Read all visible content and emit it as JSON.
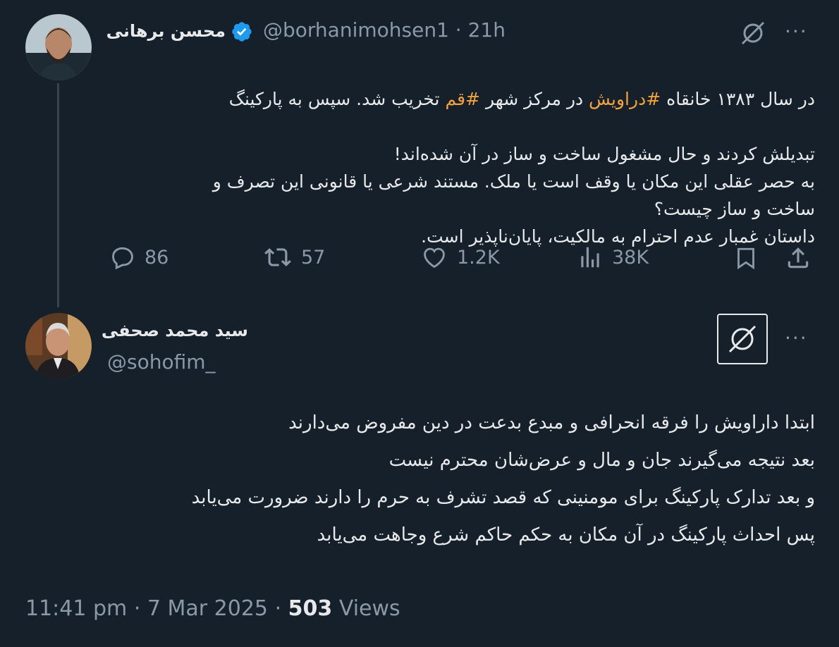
{
  "tweet1": {
    "author_name": "محسن برهانی",
    "handle": "@borhanimohsen1",
    "separator": "·",
    "time": "21h",
    "line1_a": "در سال ۱۳۸۳ خانقاه ",
    "line1_tag1": "#دراویش",
    "line1_b": " در مرکز شهر ",
    "line1_tag2": "#قم",
    "line1_c": " تخریب شد. سپس به پارکینگ",
    "lines_rest": "تبدیلش کردند و حال مشغول ساخت و ساز در آن شده‌اند!\nبه حصر عقلی این مکان یا وقف است یا ملک. مستند شرعی یا قانونی این تصرف و\nساخت و ساز چیست؟\nداستان غمبار عدم احترام به مالکیت، پایان‌ناپذیر است.",
    "stats": {
      "replies": "86",
      "retweets": "57",
      "likes": "1.2K",
      "views": "38K"
    },
    "more_label": "···"
  },
  "tweet2": {
    "author_name": "سید محمد صحفی",
    "handle": "@sohofim_",
    "more_label": "···",
    "text": "ابتدا داراویش را فرقه انحرافی و مبدع بدعت در دین مفروض می‌دارند\nبعد نتیجه می‌گیرند جان و مال و عرض‌شان محترم نیست\nو بعد تدارک پارکینگ برای مومنینی که قصد تشرف به حرم را دارند ضرورت می‌یابد\nپس احداث پارکینگ در آن مکان به حکم حاکم شرع وجاهت می‌یابد",
    "time": "11:41 pm",
    "dot": "·",
    "date": "7 Mar 2025",
    "views_count": "503",
    "views_label": "Views"
  },
  "colors": {
    "background": "#15202b",
    "hashtag": "#f4a23c",
    "verified": "#1d9bf0",
    "muted": "#8b98a5"
  },
  "icons": [
    "verified-badge-icon",
    "grok-icon",
    "reply-icon",
    "retweet-icon",
    "like-icon",
    "views-icon",
    "bookmark-icon",
    "share-icon",
    "more-icon"
  ]
}
